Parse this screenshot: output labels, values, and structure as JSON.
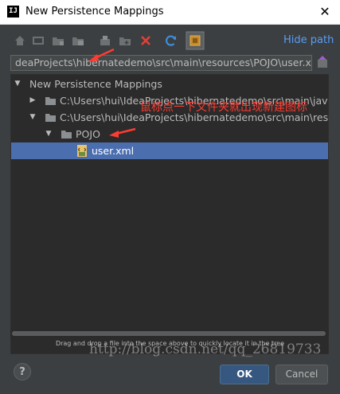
{
  "window": {
    "logo": "IJ",
    "title": "New Persistence Mappings",
    "close": "✕"
  },
  "toolbar": {
    "hide_path": "Hide path",
    "buttons": [
      "home-icon",
      "desktop-icon",
      "project-folder-icon",
      "module-folder-icon",
      "new-folder-icon",
      "new-file-icon",
      "delete-icon",
      "refresh-icon",
      "show-hidden-icon"
    ]
  },
  "path": {
    "value": "deaProjects\\hibernatedemo\\src\\main\\resources\\POJO\\user.xml"
  },
  "tree": {
    "rows": [
      {
        "label": "New Persistence Mappings",
        "expanded": true
      },
      {
        "label": "C:\\Users\\hui\\IdeaProjects\\hibernatedemo\\src\\main\\java",
        "expanded": false
      },
      {
        "label": "C:\\Users\\hui\\IdeaProjects\\hibernatedemo\\src\\main\\resources",
        "expanded": true
      },
      {
        "label": "POJO",
        "expanded": true
      },
      {
        "label": "user.xml",
        "selected": true
      }
    ]
  },
  "annotation": "鼠标点一下文件夹就出现新建图标",
  "hint": "Drag and drop a file into the space above to quickly locate it in the tree",
  "buttons": {
    "help": "?",
    "ok": "OK",
    "cancel": "Cancel"
  },
  "watermark": "http://blog.csdn.net/qq_26819733",
  "colors": {
    "background": "#3c3f41",
    "tree_bg": "#2b2b2b",
    "selection": "#4b6eaf",
    "link": "#589df6",
    "annotation": "#ff3b30"
  }
}
